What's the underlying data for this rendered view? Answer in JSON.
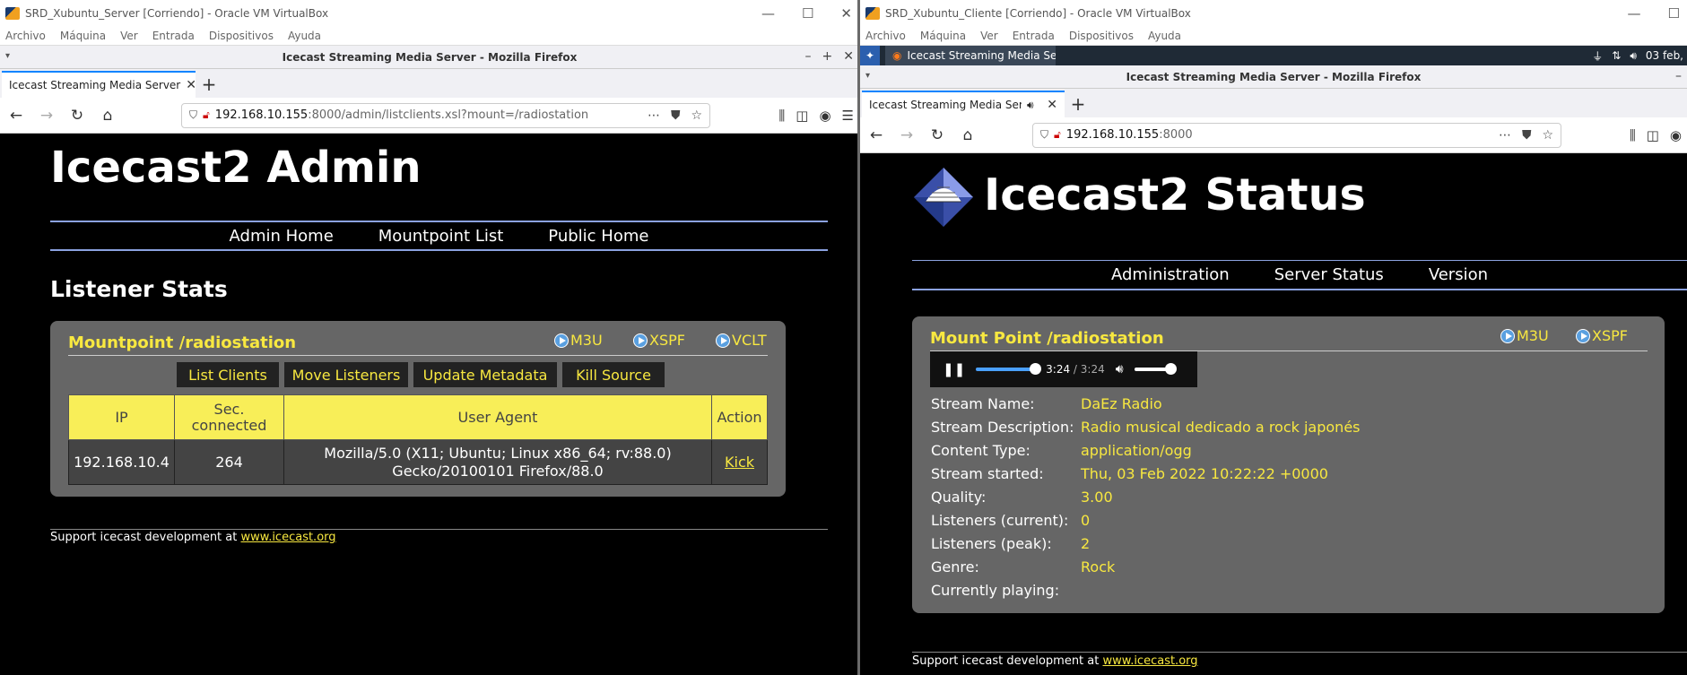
{
  "left": {
    "vbox_title": "SRD_Xubuntu_Server [Corriendo] - Oracle VM VirtualBox",
    "vbox_menu": [
      "Archivo",
      "Máquina",
      "Ver",
      "Entrada",
      "Dispositivos",
      "Ayuda"
    ],
    "window_title": "Icecast Streaming Media Server - Mozilla Firefox",
    "tab_title": "Icecast Streaming Media Server",
    "url_host": "192.168.10.155",
    "url_rest": ":8000/admin/listclients.xsl?mount=/radiostation",
    "heading": "Icecast2 Admin",
    "nav": [
      "Admin Home",
      "Mountpoint List",
      "Public Home"
    ],
    "section_title": "Listener Stats",
    "mount_title": "Mountpoint /radiostation",
    "play_links": [
      "M3U",
      "XSPF",
      "VCLT"
    ],
    "actions": [
      "List Clients",
      "Move Listeners",
      "Update Metadata",
      "Kill Source"
    ],
    "table_headers": [
      "IP",
      "Sec.\nconnected",
      "User Agent",
      "Action"
    ],
    "table_rows": [
      {
        "ip": "192.168.10.4",
        "sec": "264",
        "agent_line1": "Mozilla/5.0 (X11; Ubuntu; Linux x86_64; rv:88.0)",
        "agent_line2": "Gecko/20100101 Firefox/88.0",
        "action": "Kick"
      }
    ],
    "footer_text": "Support icecast development at ",
    "footer_link": "www.icecast.org"
  },
  "right": {
    "vbox_title": "SRD_Xubuntu_Cliente [Corriendo] - Oracle VM VirtualBox",
    "vbox_menu": [
      "Archivo",
      "Máquina",
      "Ver",
      "Entrada",
      "Dispositivos",
      "Ayuda"
    ],
    "panel_task": "Icecast Streaming Media Se...",
    "panel_clock": "03 feb,",
    "window_title": "Icecast Streaming Media Server - Mozilla Firefox",
    "tab_title": "Icecast Streaming Media Serv",
    "url_host": "192.168.10.155",
    "url_rest": ":8000",
    "heading": "Icecast2 Status",
    "nav": [
      "Administration",
      "Server Status",
      "Version"
    ],
    "mount_title": "Mount Point /radiostation",
    "play_links": [
      "M3U",
      "XSPF"
    ],
    "player": {
      "current": "3:24",
      "total": "/ 3:24",
      "progress": 1.0,
      "volume": 1.0
    },
    "info": [
      {
        "k": "Stream Name:",
        "v": "DaEz Radio"
      },
      {
        "k": "Stream Description:",
        "v": "Radio musical dedicado a rock japonés"
      },
      {
        "k": "Content Type:",
        "v": "application/ogg"
      },
      {
        "k": "Stream started:",
        "v": "Thu, 03 Feb 2022 10:22:22 +0000"
      },
      {
        "k": "Quality:",
        "v": "3.00"
      },
      {
        "k": "Listeners (current):",
        "v": "0"
      },
      {
        "k": "Listeners (peak):",
        "v": "2"
      },
      {
        "k": "Genre:",
        "v": "Rock"
      },
      {
        "k": "Currently playing:",
        "v": ""
      }
    ],
    "footer_text": "Support icecast development at ",
    "footer_link": "www.icecast.org"
  },
  "colors": {
    "accent_yellow": "#f8e840",
    "nav_line": "#8ba2e0",
    "panel": "#666666"
  }
}
